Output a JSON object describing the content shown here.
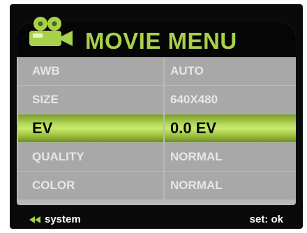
{
  "header": {
    "icon": "movie-camera-icon",
    "title": "MOVIE MENU"
  },
  "menu": {
    "items": [
      {
        "label": "AWB",
        "value": "AUTO",
        "selected": false
      },
      {
        "label": "SIZE",
        "value": "640X480",
        "selected": false
      },
      {
        "label": "EV",
        "value": "0.0 EV",
        "selected": true
      },
      {
        "label": "QUALITY",
        "value": "NORMAL",
        "selected": false
      },
      {
        "label": "COLOR",
        "value": "NORMAL",
        "selected": false
      }
    ]
  },
  "footer": {
    "back_icon": "double-left-arrow-icon",
    "back_label": "system",
    "set_label": "set: ok"
  },
  "colors": {
    "accent_green": "#a9d04a",
    "screen_bg": "#0a0a0a",
    "cell_gray": "#a8a8a8",
    "text_light": "#e6e6e6"
  }
}
